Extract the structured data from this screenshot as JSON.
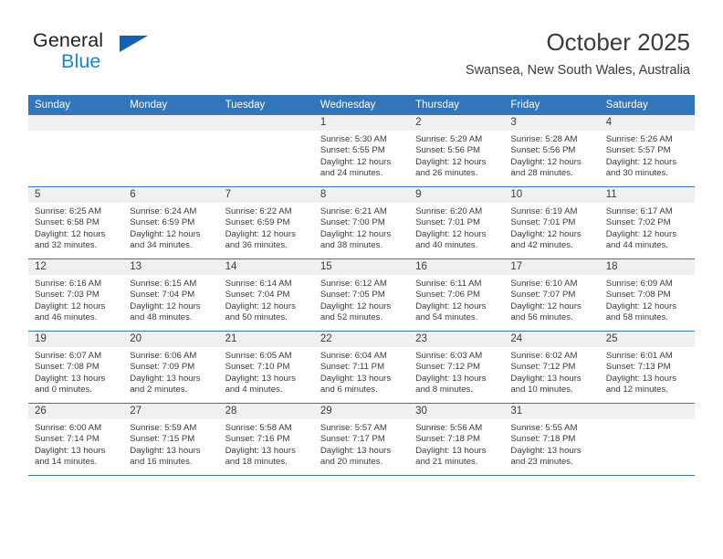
{
  "brand": {
    "name_part1": "General",
    "name_part2": "Blue",
    "triangle_icon": "brand-triangle-icon",
    "colors": {
      "dark": "#231f20",
      "blue": "#1b84d6",
      "triangle": "#1262ae"
    }
  },
  "header": {
    "title": "October 2025",
    "subtitle": "Swansea, New South Wales, Australia"
  },
  "theme": {
    "header_row_bg": "#3275bb",
    "daynum_bg": "#f0f0f0",
    "text": "#3b3b3b",
    "row_divider": "#3275bb"
  },
  "weekdays": [
    "Sunday",
    "Monday",
    "Tuesday",
    "Wednesday",
    "Thursday",
    "Friday",
    "Saturday"
  ],
  "weeks": [
    [
      {
        "day": "",
        "sunrise": "",
        "sunset": "",
        "daylight_line1": "",
        "daylight_line2": ""
      },
      {
        "day": "",
        "sunrise": "",
        "sunset": "",
        "daylight_line1": "",
        "daylight_line2": ""
      },
      {
        "day": "",
        "sunrise": "",
        "sunset": "",
        "daylight_line1": "",
        "daylight_line2": ""
      },
      {
        "day": "1",
        "sunrise": "Sunrise: 5:30 AM",
        "sunset": "Sunset: 5:55 PM",
        "daylight_line1": "Daylight: 12 hours",
        "daylight_line2": "and 24 minutes."
      },
      {
        "day": "2",
        "sunrise": "Sunrise: 5:29 AM",
        "sunset": "Sunset: 5:56 PM",
        "daylight_line1": "Daylight: 12 hours",
        "daylight_line2": "and 26 minutes."
      },
      {
        "day": "3",
        "sunrise": "Sunrise: 5:28 AM",
        "sunset": "Sunset: 5:56 PM",
        "daylight_line1": "Daylight: 12 hours",
        "daylight_line2": "and 28 minutes."
      },
      {
        "day": "4",
        "sunrise": "Sunrise: 5:26 AM",
        "sunset": "Sunset: 5:57 PM",
        "daylight_line1": "Daylight: 12 hours",
        "daylight_line2": "and 30 minutes."
      }
    ],
    [
      {
        "day": "5",
        "sunrise": "Sunrise: 6:25 AM",
        "sunset": "Sunset: 6:58 PM",
        "daylight_line1": "Daylight: 12 hours",
        "daylight_line2": "and 32 minutes."
      },
      {
        "day": "6",
        "sunrise": "Sunrise: 6:24 AM",
        "sunset": "Sunset: 6:59 PM",
        "daylight_line1": "Daylight: 12 hours",
        "daylight_line2": "and 34 minutes."
      },
      {
        "day": "7",
        "sunrise": "Sunrise: 6:22 AM",
        "sunset": "Sunset: 6:59 PM",
        "daylight_line1": "Daylight: 12 hours",
        "daylight_line2": "and 36 minutes."
      },
      {
        "day": "8",
        "sunrise": "Sunrise: 6:21 AM",
        "sunset": "Sunset: 7:00 PM",
        "daylight_line1": "Daylight: 12 hours",
        "daylight_line2": "and 38 minutes."
      },
      {
        "day": "9",
        "sunrise": "Sunrise: 6:20 AM",
        "sunset": "Sunset: 7:01 PM",
        "daylight_line1": "Daylight: 12 hours",
        "daylight_line2": "and 40 minutes."
      },
      {
        "day": "10",
        "sunrise": "Sunrise: 6:19 AM",
        "sunset": "Sunset: 7:01 PM",
        "daylight_line1": "Daylight: 12 hours",
        "daylight_line2": "and 42 minutes."
      },
      {
        "day": "11",
        "sunrise": "Sunrise: 6:17 AM",
        "sunset": "Sunset: 7:02 PM",
        "daylight_line1": "Daylight: 12 hours",
        "daylight_line2": "and 44 minutes."
      }
    ],
    [
      {
        "day": "12",
        "sunrise": "Sunrise: 6:16 AM",
        "sunset": "Sunset: 7:03 PM",
        "daylight_line1": "Daylight: 12 hours",
        "daylight_line2": "and 46 minutes."
      },
      {
        "day": "13",
        "sunrise": "Sunrise: 6:15 AM",
        "sunset": "Sunset: 7:04 PM",
        "daylight_line1": "Daylight: 12 hours",
        "daylight_line2": "and 48 minutes."
      },
      {
        "day": "14",
        "sunrise": "Sunrise: 6:14 AM",
        "sunset": "Sunset: 7:04 PM",
        "daylight_line1": "Daylight: 12 hours",
        "daylight_line2": "and 50 minutes."
      },
      {
        "day": "15",
        "sunrise": "Sunrise: 6:12 AM",
        "sunset": "Sunset: 7:05 PM",
        "daylight_line1": "Daylight: 12 hours",
        "daylight_line2": "and 52 minutes."
      },
      {
        "day": "16",
        "sunrise": "Sunrise: 6:11 AM",
        "sunset": "Sunset: 7:06 PM",
        "daylight_line1": "Daylight: 12 hours",
        "daylight_line2": "and 54 minutes."
      },
      {
        "day": "17",
        "sunrise": "Sunrise: 6:10 AM",
        "sunset": "Sunset: 7:07 PM",
        "daylight_line1": "Daylight: 12 hours",
        "daylight_line2": "and 56 minutes."
      },
      {
        "day": "18",
        "sunrise": "Sunrise: 6:09 AM",
        "sunset": "Sunset: 7:08 PM",
        "daylight_line1": "Daylight: 12 hours",
        "daylight_line2": "and 58 minutes."
      }
    ],
    [
      {
        "day": "19",
        "sunrise": "Sunrise: 6:07 AM",
        "sunset": "Sunset: 7:08 PM",
        "daylight_line1": "Daylight: 13 hours",
        "daylight_line2": "and 0 minutes."
      },
      {
        "day": "20",
        "sunrise": "Sunrise: 6:06 AM",
        "sunset": "Sunset: 7:09 PM",
        "daylight_line1": "Daylight: 13 hours",
        "daylight_line2": "and 2 minutes."
      },
      {
        "day": "21",
        "sunrise": "Sunrise: 6:05 AM",
        "sunset": "Sunset: 7:10 PM",
        "daylight_line1": "Daylight: 13 hours",
        "daylight_line2": "and 4 minutes."
      },
      {
        "day": "22",
        "sunrise": "Sunrise: 6:04 AM",
        "sunset": "Sunset: 7:11 PM",
        "daylight_line1": "Daylight: 13 hours",
        "daylight_line2": "and 6 minutes."
      },
      {
        "day": "23",
        "sunrise": "Sunrise: 6:03 AM",
        "sunset": "Sunset: 7:12 PM",
        "daylight_line1": "Daylight: 13 hours",
        "daylight_line2": "and 8 minutes."
      },
      {
        "day": "24",
        "sunrise": "Sunrise: 6:02 AM",
        "sunset": "Sunset: 7:12 PM",
        "daylight_line1": "Daylight: 13 hours",
        "daylight_line2": "and 10 minutes."
      },
      {
        "day": "25",
        "sunrise": "Sunrise: 6:01 AM",
        "sunset": "Sunset: 7:13 PM",
        "daylight_line1": "Daylight: 13 hours",
        "daylight_line2": "and 12 minutes."
      }
    ],
    [
      {
        "day": "26",
        "sunrise": "Sunrise: 6:00 AM",
        "sunset": "Sunset: 7:14 PM",
        "daylight_line1": "Daylight: 13 hours",
        "daylight_line2": "and 14 minutes."
      },
      {
        "day": "27",
        "sunrise": "Sunrise: 5:59 AM",
        "sunset": "Sunset: 7:15 PM",
        "daylight_line1": "Daylight: 13 hours",
        "daylight_line2": "and 16 minutes."
      },
      {
        "day": "28",
        "sunrise": "Sunrise: 5:58 AM",
        "sunset": "Sunset: 7:16 PM",
        "daylight_line1": "Daylight: 13 hours",
        "daylight_line2": "and 18 minutes."
      },
      {
        "day": "29",
        "sunrise": "Sunrise: 5:57 AM",
        "sunset": "Sunset: 7:17 PM",
        "daylight_line1": "Daylight: 13 hours",
        "daylight_line2": "and 20 minutes."
      },
      {
        "day": "30",
        "sunrise": "Sunrise: 5:56 AM",
        "sunset": "Sunset: 7:18 PM",
        "daylight_line1": "Daylight: 13 hours",
        "daylight_line2": "and 21 minutes."
      },
      {
        "day": "31",
        "sunrise": "Sunrise: 5:55 AM",
        "sunset": "Sunset: 7:18 PM",
        "daylight_line1": "Daylight: 13 hours",
        "daylight_line2": "and 23 minutes."
      },
      {
        "day": "",
        "sunrise": "",
        "sunset": "",
        "daylight_line1": "",
        "daylight_line2": ""
      }
    ]
  ]
}
